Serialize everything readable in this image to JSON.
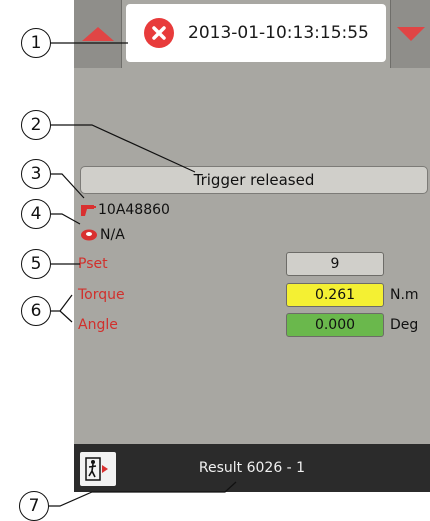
{
  "header": {
    "timestamp": "2013-01-10:13:15:55",
    "status_icon": "error-circle-x-icon",
    "prev_icon": "triangle-up-icon",
    "next_icon": "triangle-down-icon"
  },
  "status": {
    "message": "Trigger released"
  },
  "tool": {
    "id": "10A48860",
    "icon": "tool-icon"
  },
  "socket": {
    "value": "N/A",
    "icon": "socket-icon"
  },
  "params": {
    "pset": {
      "label": "Pset",
      "value": "9",
      "unit": ""
    },
    "torque": {
      "label": "Torque",
      "value": "0.261",
      "unit": "N.m"
    },
    "angle": {
      "label": "Angle",
      "value": "0.000",
      "unit": "Deg"
    }
  },
  "footer": {
    "result": "Result 6026 - 1",
    "exit_icon": "exit-door-icon"
  },
  "callouts": [
    "1",
    "2",
    "3",
    "4",
    "5",
    "6",
    "7"
  ],
  "colors": {
    "screen_bg": "#a8a7a2",
    "error": "#e83b3b",
    "label_red": "#d1302c",
    "torque_box": "#f4f033",
    "angle_box": "#6ab84c",
    "bottom_bar": "#2b2b2b"
  }
}
